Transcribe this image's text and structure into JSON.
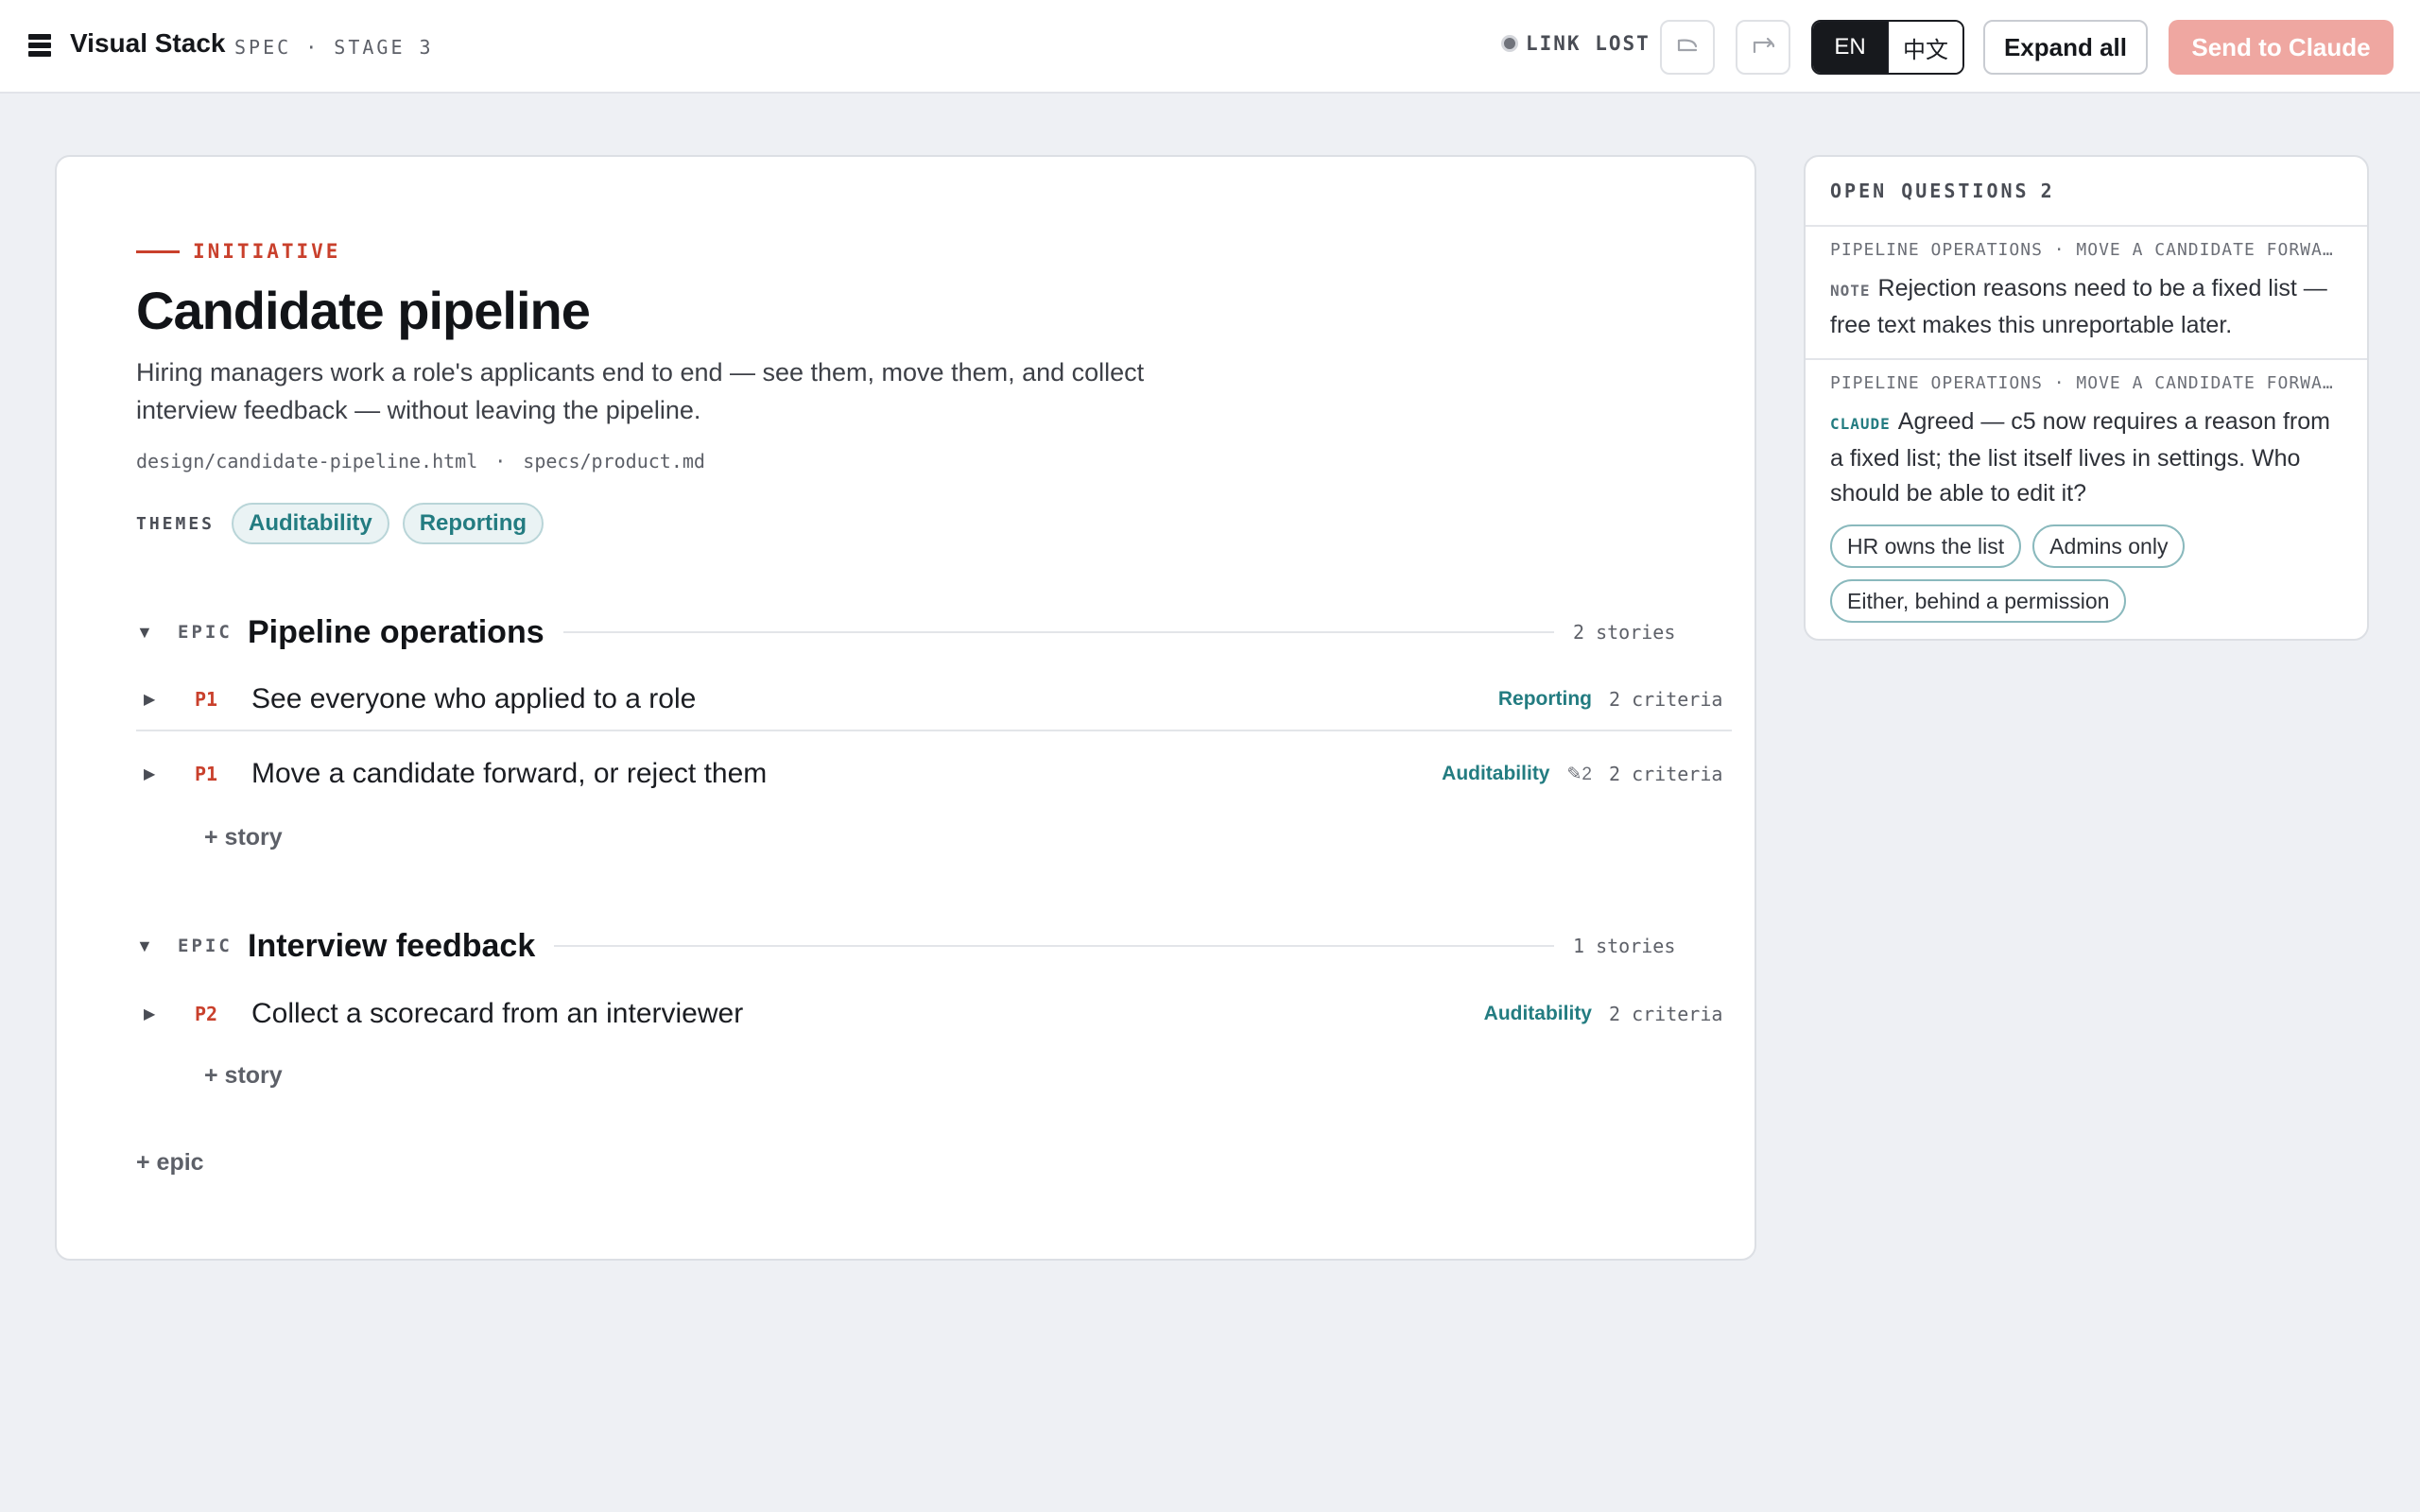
{
  "header": {
    "app_title": "Visual Stack",
    "subtitle": "SPEC · STAGE 3",
    "status": "LINK LOST",
    "lang_en": "EN",
    "lang_zh": "中文",
    "expand_label": "Expand all",
    "send_label": "Send to Claude"
  },
  "initiative": {
    "kicker": "INITIATIVE",
    "title": "Candidate pipeline",
    "description": "Hiring managers work a role's applicants end to end — see them, move them, and collect interview feedback — without leaving the pipeline.",
    "link_design": "design/candidate-pipeline.html",
    "link_sep": "·",
    "link_spec": "specs/product.md",
    "themes_label": "THEMES",
    "themes": [
      "Auditability",
      "Reporting"
    ]
  },
  "epic_tag": "EPIC",
  "epics": [
    {
      "name": "Pipeline operations",
      "count": "2 stories",
      "stories": [
        {
          "priority": "P1",
          "title": "See everyone who applied to a role",
          "theme": "Reporting",
          "edits": "",
          "criteria": "2 criteria"
        },
        {
          "priority": "P1",
          "title": "Move a candidate forward, or reject them",
          "theme": "Auditability",
          "edits": "✎2",
          "criteria": "2 criteria"
        }
      ],
      "add_story": "+ story"
    },
    {
      "name": "Interview feedback",
      "count": "1 stories",
      "stories": [
        {
          "priority": "P2",
          "title": "Collect a scorecard from an interviewer",
          "theme": "Auditability",
          "edits": "",
          "criteria": "2 criteria"
        }
      ],
      "add_story": "+ story"
    }
  ],
  "add_epic": "+ epic",
  "questions": {
    "heading": "OPEN QUESTIONS",
    "count": "2",
    "items": [
      {
        "context": "PIPELINE OPERATIONS · MOVE A CANDIDATE FORWARD, OR REJECT THEM",
        "who": "NOTE",
        "text": "Rejection reasons need to be a fixed list — free text makes this unreportable later."
      },
      {
        "context": "PIPELINE OPERATIONS · MOVE A CANDIDATE FORWARD, OR REJECT THEM",
        "who": "CLAUDE",
        "text": "Agreed — c5 now requires a reason from a fixed list; the list itself lives in settings. Who should be able to edit it?",
        "choices": [
          "HR owns the list",
          "Admins only",
          "Either, behind a permission"
        ]
      }
    ]
  }
}
